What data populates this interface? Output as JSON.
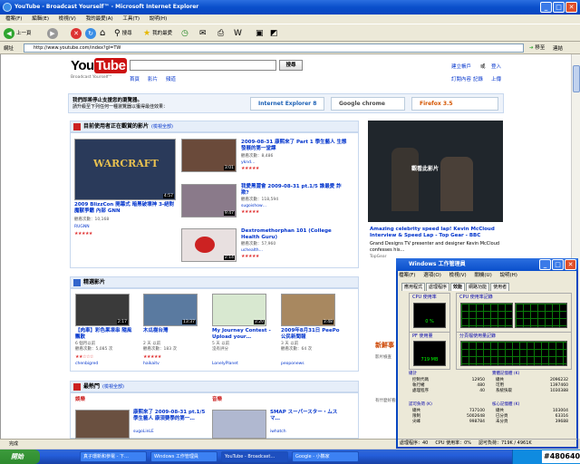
{
  "window": {
    "title": "YouTube - Broadcast Yourself™ - Microsoft Internet Explorer"
  },
  "menubar": [
    "檔案(F)",
    "編輯(E)",
    "檢視(V)",
    "我的最愛(A)",
    "工具(T)",
    "說明(H)"
  ],
  "toolbar": {
    "back": "上一頁",
    "search": "搜尋",
    "favorites": "我的最愛"
  },
  "address": {
    "label": "網址",
    "value": "http://www.youtube.com/index?gl=TW",
    "go": "移至",
    "links": "連結"
  },
  "youtube": {
    "logo_you": "You",
    "logo_tube": "Tube",
    "tagline": "Broadcast Yourself™",
    "search_button": "搜尋",
    "nav": [
      "首頁",
      "影片",
      "頻道"
    ],
    "top_links": [
      "建立帳戶",
      "或",
      "登入"
    ],
    "sub_links": [
      "訂閱內容",
      "記錄",
      "上傳"
    ],
    "banner": {
      "line1": "我們即將停止支援您的瀏覽器。",
      "line2": "請升級至下列任何一種瀏覽器以獲得最佳效果：",
      "browsers": [
        "Internet Explorer 8",
        "Google chrome",
        "Firefox 3.5"
      ]
    },
    "sections": [
      {
        "title": "目前使用者正在觀賞的影片",
        "sub": "(檢視全部)"
      },
      {
        "title": "精選影片",
        "sub": ""
      },
      {
        "title": "最熱門",
        "sub": "(檢視全部)"
      }
    ],
    "main_video": {
      "title": "2009 BlizzCon 開幕式 暗黑破壞神 3-絕對 魔獸爭霸 內部 GNN",
      "views": "觀看次數：10,168",
      "user": "RUGNN",
      "duration": "4:57"
    },
    "watching": [
      {
        "title": "2009-08-31 康熙來了 Part 1 學生藝人 生態發展的第一堂課",
        "views": "觀看次數：8,486",
        "user": "yknd…",
        "duration": "3:01"
      },
      {
        "title": "我愛黑澀會 2009-08-31 pt.1/5 誰最愛 詐欺?",
        "views": "觀看次數：118,594",
        "user": "sugoishow…",
        "duration": "9:47"
      },
      {
        "title": "Dextromethorphan 101 (College Health Guru)",
        "views": "觀看次數：57,960",
        "user": "uchealth…",
        "duration": "2:14"
      }
    ],
    "side_video": {
      "overlay": "觀看此影片",
      "title": "Amazing celebrity speed lap! Kevin McCloud Interview & Speed Lap - Top Gear - BBC",
      "desc": "Grand Designs TV presenter and designer Kevin McCloud confesses his…",
      "user": "TopGear"
    },
    "featured": [
      {
        "title": "【肉車】彩色果凍串 隨風飄散",
        "meta": "6 個月以前\n觀看次數：5,085 次",
        "user": "chenbigred",
        "duration": "2:17"
      },
      {
        "title": "木瓜樹台灣",
        "meta": "2 天 以前\n觀看次數：183 次",
        "user": "haikaitv",
        "duration": "13:37"
      },
      {
        "title": "My Journey Contest - Upload your…",
        "meta": "5 天 以前\n沒有評分",
        "user": "LonelyPlanet",
        "duration": "3:20"
      },
      {
        "title": "2009年8月31日 PeePo 公民新聞報",
        "meta": "3 天 以前\n觀看次數：64 次",
        "user": "peoponews",
        "duration": "3:48"
      }
    ],
    "popular_left": {
      "category": "娛樂",
      "title": "康熙來了 2009-08-31 pt.1/5 學生藝人 康須要學的第一…",
      "user": "sugoLinLE"
    },
    "popular_right": {
      "category": "音樂",
      "title": "SMAP スーパースター・ムスマ…",
      "user": "iwhatch"
    },
    "right_col": [
      "新鮮事",
      "影片檢查",
      "有什麼好看的"
    ]
  },
  "ie_status": "完成",
  "taskmgr": {
    "title": "Windows 工作管理員",
    "menu": [
      "檔案(F)",
      "選項(O)",
      "檢視(V)",
      "關機(U)",
      "說明(H)"
    ],
    "tabs": [
      "應用程式",
      "處理程序",
      "效能",
      "網路功能",
      "使用者"
    ],
    "cpu_label": "CPU 使用率",
    "cpu_hist": "CPU 使用率記錄",
    "pf_label": "PF 使用量",
    "pf_hist": "分頁檔使用量記錄",
    "cpu_value": "0 %",
    "pf_value": "719 MB",
    "totals": {
      "label": "總計",
      "rows": [
        [
          "控制代碼",
          "12950"
        ],
        [
          "執行緒",
          "480"
        ],
        [
          "處理程序",
          "40"
        ]
      ]
    },
    "physical": {
      "label": "實體記憶體 (K)",
      "rows": [
        [
          "總共",
          "2096232"
        ],
        [
          "可用",
          "1397460"
        ],
        [
          "系統快取",
          "1030388"
        ]
      ]
    },
    "commit": {
      "label": "認可負荷 (K)",
      "rows": [
        [
          "總共",
          "737100"
        ],
        [
          "限制",
          "5002648"
        ],
        [
          "尖峰",
          "998784"
        ]
      ]
    },
    "kernel": {
      "label": "核心記憶體 (K)",
      "rows": [
        [
          "總共",
          "103004"
        ],
        [
          "已分頁",
          "63316"
        ],
        [
          "未分頁",
          "39688"
        ]
      ]
    },
    "status": [
      "處理程序：40",
      "CPU 使用率：0%",
      "認可負荷：719K / 4961K"
    ]
  },
  "taskbar": {
    "start": "開始",
    "tasks": [
      "真子環新和參電 - 下…",
      "Windows 工作管理員",
      "YouTube - Broadcast…",
      "Google - 小鸚家"
    ],
    "clock": "#480640"
  },
  "colors": {
    "xp_blue": "#0a4fcb",
    "yt_red": "#cc1111",
    "link": "#0033cc",
    "stars": "#e03333"
  }
}
